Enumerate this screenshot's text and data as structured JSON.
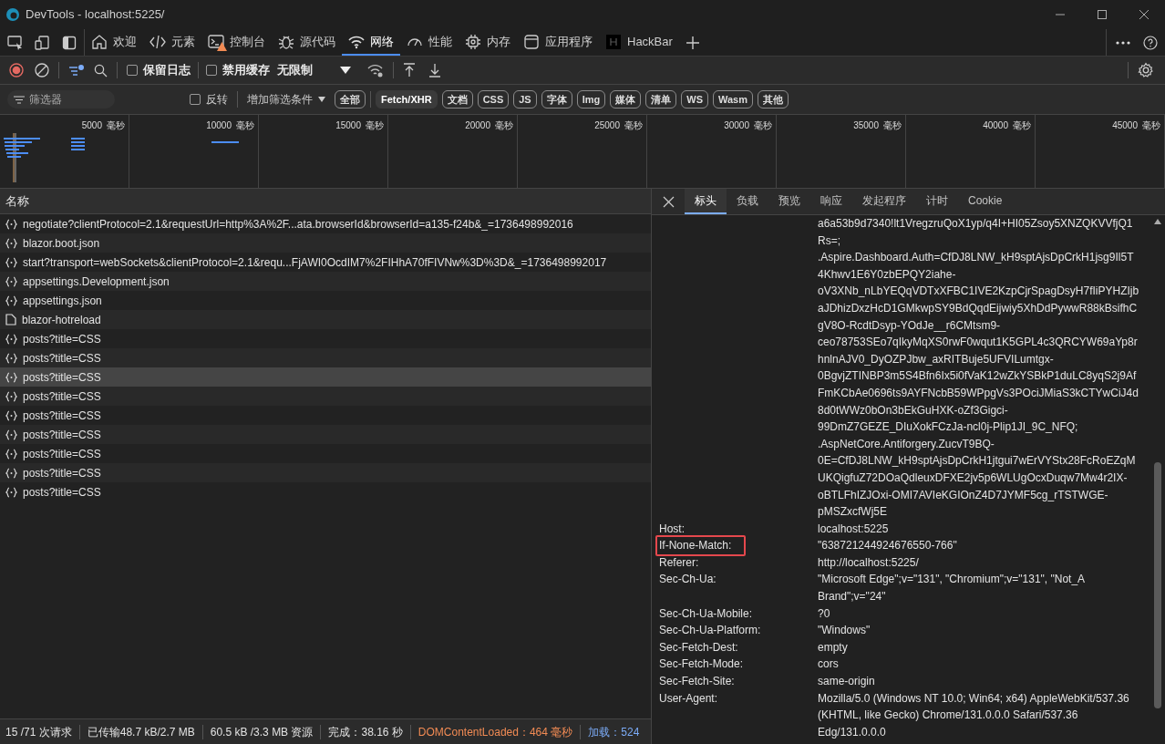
{
  "window": {
    "title": "DevTools - localhost:5225/"
  },
  "main_tabs": [
    {
      "label": "欢迎",
      "selected": false,
      "warning": false
    },
    {
      "label": "元素",
      "selected": false,
      "warning": false
    },
    {
      "label": "控制台",
      "selected": false,
      "warning": true
    },
    {
      "label": "源代码",
      "selected": false,
      "warning": false
    },
    {
      "label": "网络",
      "selected": true,
      "warning": false
    },
    {
      "label": "性能",
      "selected": false,
      "warning": false
    },
    {
      "label": "内存",
      "selected": false,
      "warning": false
    },
    {
      "label": "应用程序",
      "selected": false,
      "warning": false
    },
    {
      "label": "HackBar",
      "selected": false,
      "warning": false
    }
  ],
  "toolbar": {
    "checkboxes": [
      {
        "label": "保留日志",
        "checked": false
      },
      {
        "label": "禁用缓存",
        "checked": false
      }
    ],
    "throttling": "无限制"
  },
  "filter_bar": {
    "placeholder": "筛选器",
    "invert": {
      "label": "反转",
      "checked": false
    },
    "more_filters": "增加筛选条件",
    "chips": [
      {
        "label": "全部",
        "selected": false
      },
      {
        "label": "Fetch/XHR",
        "selected": true
      },
      {
        "label": "文档",
        "selected": false
      },
      {
        "label": "CSS",
        "selected": false
      },
      {
        "label": "JS",
        "selected": false
      },
      {
        "label": "字体",
        "selected": false
      },
      {
        "label": "Img",
        "selected": false
      },
      {
        "label": "媒体",
        "selected": false
      },
      {
        "label": "清单",
        "selected": false
      },
      {
        "label": "WS",
        "selected": false
      },
      {
        "label": "Wasm",
        "selected": false
      },
      {
        "label": "其他",
        "selected": false
      }
    ]
  },
  "overview": {
    "ticks": [
      {
        "value": "5000",
        "unit": "毫秒"
      },
      {
        "value": "10000",
        "unit": "毫秒"
      },
      {
        "value": "15000",
        "unit": "毫秒"
      },
      {
        "value": "20000",
        "unit": "毫秒"
      },
      {
        "value": "25000",
        "unit": "毫秒"
      },
      {
        "value": "30000",
        "unit": "毫秒"
      },
      {
        "value": "35000",
        "unit": "毫秒"
      },
      {
        "value": "40000",
        "unit": "毫秒"
      },
      {
        "value": "45000",
        "unit": "毫秒"
      }
    ]
  },
  "requests": {
    "column": "名称",
    "rows": [
      {
        "name": "negotiate?clientProtocol=2.1&requestUrl=http%3A%2F...ata.browserId&browserId=a135-f24b&_=1736498992016",
        "kind": "fetch",
        "selected": false
      },
      {
        "name": "blazor.boot.json",
        "kind": "fetch",
        "selected": false
      },
      {
        "name": "start?transport=webSockets&clientProtocol=2.1&requ...FjAWI0OcdIM7%2FIHhA70fFIVNw%3D%3D&_=1736498992017",
        "kind": "fetch",
        "selected": false
      },
      {
        "name": "appsettings.Development.json",
        "kind": "fetch",
        "selected": false
      },
      {
        "name": "appsettings.json",
        "kind": "fetch",
        "selected": false
      },
      {
        "name": "blazor-hotreload",
        "kind": "document",
        "selected": false
      },
      {
        "name": "posts?title=CSS",
        "kind": "fetch",
        "selected": false
      },
      {
        "name": "posts?title=CSS",
        "kind": "fetch",
        "selected": false
      },
      {
        "name": "posts?title=CSS",
        "kind": "fetch",
        "selected": true
      },
      {
        "name": "posts?title=CSS",
        "kind": "fetch",
        "selected": false
      },
      {
        "name": "posts?title=CSS",
        "kind": "fetch",
        "selected": false
      },
      {
        "name": "posts?title=CSS",
        "kind": "fetch",
        "selected": false
      },
      {
        "name": "posts?title=CSS",
        "kind": "fetch",
        "selected": false
      },
      {
        "name": "posts?title=CSS",
        "kind": "fetch",
        "selected": false
      },
      {
        "name": "posts?title=CSS",
        "kind": "fetch",
        "selected": false
      }
    ]
  },
  "details": {
    "tabs": [
      {
        "label": "标头",
        "selected": true
      },
      {
        "label": "负载",
        "selected": false
      },
      {
        "label": "预览",
        "selected": false
      },
      {
        "label": "响应",
        "selected": false
      },
      {
        "label": "发起程序",
        "selected": false
      },
      {
        "label": "计时",
        "selected": false
      },
      {
        "label": "Cookie",
        "selected": false
      }
    ],
    "headers": [
      {
        "value": "a6a53b9d7340!lt1VregzruQoX1yp/q4I+HI05Zsoy5XNZQKVVfjQ1Rs=; .Aspire.Dashboard.Auth=CfDJ8LNW_kH9sptAjsDpCrkH1jsg9Il5T4Khwv1E6Y0zbEPQY2iahe-oV3XNb_nLbYEQqVDTxXFBC1IVE2KzpCjrSpagDsyH7fIiPYHZIjbaJDhizDxzHcD1GMkwpSY9BdQqdEijwiy5XhDdPywwR88kBsifhCgV8O-RcdtDsyp-YOdJe__r6CMtsm9-ceo78753SEo7qIkyMqXS0rwF0wqut1K5GPL4c3QRCYW69aYp8rhnlnAJV0_DyOZPJbw_axRITBuje5UFVILumtgx-0BgvjZTINBP3m5S4Bfn6Ix5i0fVaK12wZkYSBkP1duLC8yqS2j9AfFmKCbAe0696ts9AYFNcbB59WPpgVs3POciJMiaS3kCTYwCiJ4d8d0tWWz0bOn3bEkGuHXK-oZf3Gigci-99DmZ7GEZE_DIuXokFCzJa-ncl0j-Plip1JI_9C_NFQ; .AspNetCore.Antiforgery.ZucvT9BQ-0E=CfDJ8LNW_kH9sptAjsDpCrkH1jtgui7wErVYStx28FcRoEZqMUKQigfuZ72DOaQdleuxDFXE2jv5p6WLUgOcxDuqw7Mw4r2IX-oBTLFhIZJOxi-OMI7AVIeKGIOnZ4D7JYMF5cg_rTSTWGE-pMSZxcfWj5E",
        "highlighted": false
      },
      {
        "name": "Host:",
        "value": "localhost:5225",
        "highlighted": false
      },
      {
        "name": "If-None-Match:",
        "value": "\"638721244924676550-766\"",
        "highlighted": true
      },
      {
        "name": "Referer:",
        "value": "http://localhost:5225/",
        "highlighted": false
      },
      {
        "name": "Sec-Ch-Ua:",
        "value": "\"Microsoft Edge\";v=\"131\", \"Chromium\";v=\"131\", \"Not_A Brand\";v=\"24\"",
        "highlighted": false
      },
      {
        "name": "Sec-Ch-Ua-Mobile:",
        "value": "?0",
        "highlighted": false
      },
      {
        "name": "Sec-Ch-Ua-Platform:",
        "value": "\"Windows\"",
        "highlighted": false
      },
      {
        "name": "Sec-Fetch-Dest:",
        "value": "empty",
        "highlighted": false
      },
      {
        "name": "Sec-Fetch-Mode:",
        "value": "cors",
        "highlighted": false
      },
      {
        "name": "Sec-Fetch-Site:",
        "value": "same-origin",
        "highlighted": false
      },
      {
        "name": "User-Agent:",
        "value": "Mozilla/5.0 (Windows NT 10.0; Win64; x64) AppleWebKit/537.36 (KHTML, like Gecko) Chrome/131.0.0.0 Safari/537.36 Edg/131.0.0.0",
        "highlighted": false
      }
    ]
  },
  "status_bar": [
    {
      "text": "15 /71 次请求",
      "kind": "plain"
    },
    {
      "text": "已传输48.7 kB/2.7 MB",
      "kind": "plain"
    },
    {
      "text": "60.5 kB /3.3 MB 资源",
      "kind": "plain"
    },
    {
      "text": "完成：38.16 秒",
      "kind": "plain"
    },
    {
      "text": "DOMContentLoaded：464 毫秒",
      "kind": "dcl"
    },
    {
      "text": "加载：524",
      "kind": "load"
    }
  ]
}
